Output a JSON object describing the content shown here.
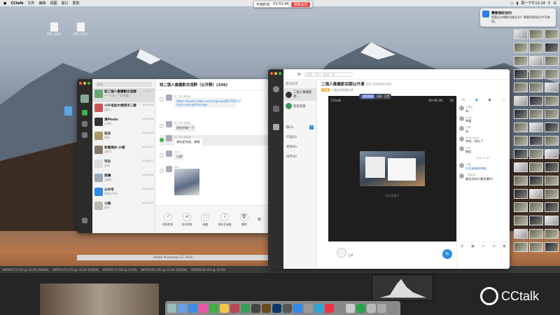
{
  "menubar": {
    "app": "CCtalk",
    "items": [
      "文件",
      "编辑",
      "视图",
      "窗口",
      "帮助"
    ],
    "clock": "周一下午12:14"
  },
  "timer": {
    "label": "可用时长",
    "time": "03:53:44",
    "action": "领取会员"
  },
  "notification": {
    "title": "需要授权访问",
    "body": "您要允许辅助功能访问？需要您授权后才可使用。"
  },
  "desktop": {
    "icon_labels": [
      "IMG_1234",
      "IMG_1235",
      "IMG_1236"
    ]
  },
  "winA": {
    "search_placeholder": "搜索",
    "chats": [
      {
        "title": "知二强人像摄影交流群",
        "sub": "一个人在一个家的路上",
        "date": "18:12"
      },
      {
        "title": "小午电动大佛西市二群",
        "sub": "[图片]",
        "date": "18/06/18"
      },
      {
        "title": "课Photo",
        "sub": "[分享]",
        "date": "18/06/18"
      },
      {
        "title": "佳白",
        "sub": "你好",
        "date": "18/06/18"
      },
      {
        "title": "封面美女-小雨",
        "sub": "[图片]",
        "date": "18/06/17"
      },
      {
        "title": "可乐",
        "sub": "好的",
        "date": "18/06/17"
      },
      {
        "title": "润澜",
        "sub": "[链接]",
        "date": "18/06/16"
      },
      {
        "title": "公众号",
        "sub": "你的公众号",
        "date": "18/06/15"
      },
      {
        "title": "小麻",
        "sub": "好的",
        "date": "18/06/15"
      }
    ],
    "chat_title": "知二强人像摄影交流群（公开群）(336)",
    "messages": [
      {
        "name": "知二强人像摄影",
        "text": "https://www.cctalk.com/m/group/85702011?from=groupmessage"
      },
      {
        "name": "知二强人像摄影",
        "text": "现在完成一下"
      },
      {
        "name": "知二强人像摄影",
        "text": "请在此完成，谢谢"
      },
      {
        "name": "Aoki",
        "text": "已经"
      },
      {
        "name": "Aoki",
        "text": ""
      }
    ],
    "toolbar": [
      "逐条转发",
      "合并转发",
      "收藏",
      "保存至电脑",
      "删除"
    ]
  },
  "photoshop": {
    "title": "Adobe Photoshop CC 2018",
    "tabs": [
      "KKTA0173.CR3 @ 14.4% (RGB/8)",
      "KKTA0173.CR3 @ 14.4% (RGB/8)",
      "KKTA0171.CR3 @ 14.4%",
      "KKTA0161.CR3 @ 14.4% (RGB/8)",
      "KKTA0158.CR3 @ 14.4%"
    ]
  },
  "winB": {
    "search_placeholder": "搜索：用户、群组、课",
    "recent": "最近联系",
    "group_item": "二强人像摄影后...",
    "verify": "验证消息",
    "groups": [
      {
        "name": "群",
        "count": "(1)"
      },
      {
        "name": "产品",
        "count": "(0)"
      },
      {
        "name": "老师",
        "count": "(0)"
      },
      {
        "name": "同学",
        "count": "(0)"
      }
    ],
    "title": "二强人像摄影后期公开课",
    "id": "(ID:2054558)",
    "tag": "直播",
    "sub": "二强老师直播分享",
    "video": {
      "label": "CCtalk",
      "rec": "00:06:36",
      "count": "20",
      "caption": "正在观看中",
      "tool": [
        "视频直播",
        "屏幕",
        "设置"
      ]
    },
    "right_msgs": [
      {
        "name": "小助手",
        "text": "有"
      },
      {
        "name": "Andy",
        "text": "带着"
      },
      {
        "name": "小锋",
        "text": "有"
      },
      {
        "name": "Andy yang",
        "text": "哈哈，错过了"
      },
      {
        "name": "小龙",
        "text": "确定"
      },
      {
        "name": "小曾",
        "text": "节目录制结束啦。",
        "blue": true
      },
      {
        "name": "二强老师",
        "text": "确定没有打算直播吗？"
      }
    ],
    "right_time": "昨天 15:40",
    "teacher": "主讲"
  }
}
